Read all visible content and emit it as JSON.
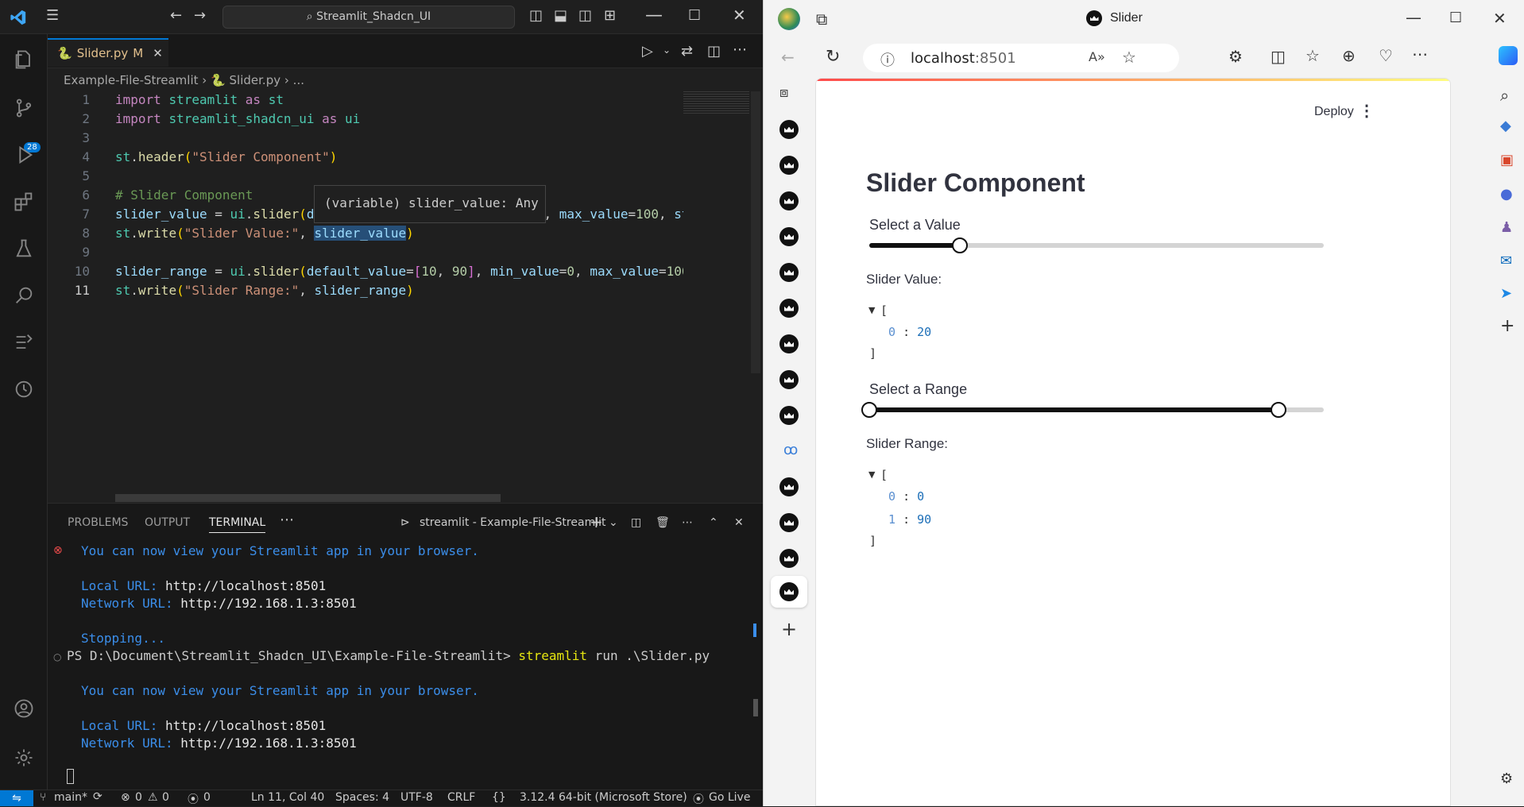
{
  "vscode": {
    "search": "Streamlit_Shadcn_UI",
    "scm_badge": "28",
    "tab": {
      "name": "Slider.py",
      "status": "M"
    },
    "breadcrumb": {
      "folder": "Example-File-Streamlit",
      "file": "Slider.py",
      "more": "..."
    },
    "hover": "(variable) slider_value: Any",
    "line_numbers": [
      "1",
      "2",
      "3",
      "4",
      "5",
      "6",
      "7",
      "8",
      "9",
      "10",
      "11"
    ],
    "panel_tabs": [
      "PROBLEMS",
      "OUTPUT",
      "TERMINAL"
    ],
    "panel_more": "⋯",
    "terminal_title": "streamlit - Example-File-Streamlit",
    "terminal": {
      "l1": "You can now view your Streamlit app in your browser.",
      "l2_label": "Local URL: ",
      "l2_value": "http://localhost:8501",
      "l3_label": "Network URL: ",
      "l3_value": "http://192.168.1.3:8501",
      "l4": "Stopping...",
      "l5_prompt": "PS D:\\Document\\Streamlit_Shadcn_UI\\Example-File-Streamlit> ",
      "l5_cmd": "streamlit",
      "l5_args": " run .\\Slider.py",
      "l6": "You can now view your Streamlit app in your browser.",
      "l7_label": "Local URL: ",
      "l7_value": "http://localhost:8501",
      "l8_label": "Network URL: ",
      "l8_value": "http://192.168.1.3:8501"
    },
    "status": {
      "branch": "main*",
      "errors": "0",
      "warnings": "0",
      "ports": "0",
      "position": "Ln 11, Col 40",
      "spaces": "Spaces: 4",
      "encoding": "UTF-8",
      "eol": "CRLF",
      "braces": "{}",
      "python": "3.12.4 64-bit (Microsoft Store)",
      "golive": "Go Live"
    }
  },
  "edge": {
    "tab_title": "Slider",
    "url_host": "localhost",
    "url_port": ":8501"
  },
  "app": {
    "deploy": "Deploy",
    "header": "Slider Component",
    "slider1": {
      "label": "Select a Value",
      "value": 20,
      "min": 0,
      "max": 100
    },
    "value_label": "Slider Value:",
    "slider2": {
      "label": "Select a Range",
      "low": 0,
      "high": 90,
      "min": 0,
      "max": 100
    },
    "range_label": "Slider Range:",
    "json_open": "[",
    "json_close": "]",
    "colon": ":",
    "value_json": [
      {
        "k": "0",
        "v": "20"
      }
    ],
    "range_json": [
      {
        "k": "0",
        "v": "0"
      },
      {
        "k": "1",
        "v": "90"
      }
    ]
  }
}
